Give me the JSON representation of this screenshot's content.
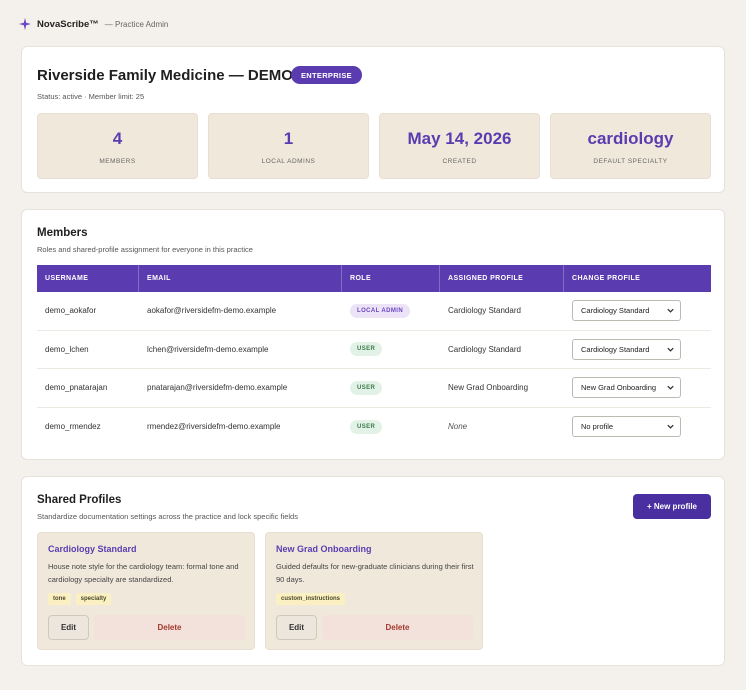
{
  "header": {
    "brand": "NovaScribe™",
    "subtitle": "— Practice Admin",
    "icon": "sparkle-icon"
  },
  "practice": {
    "name": "Riverside Family Medicine — DEMO",
    "plan_badge": "ENTERPRISE",
    "status_line": "Status: active · Member limit: 25",
    "stats": [
      {
        "value": "4",
        "label": "MEMBERS"
      },
      {
        "value": "1",
        "label": "LOCAL ADMINS"
      },
      {
        "value": "May 14, 2026",
        "label": "CREATED"
      },
      {
        "value": "cardiology",
        "label": "DEFAULT SPECIALTY"
      }
    ]
  },
  "members": {
    "title": "Members",
    "subtitle": "Roles and shared-profile assignment for everyone in this practice",
    "columns": [
      "USERNAME",
      "EMAIL",
      "ROLE",
      "ASSIGNED PROFILE",
      "CHANGE PROFILE"
    ],
    "rows": [
      {
        "username": "demo_aokafor",
        "email": "aokafor@riversidefm-demo.example",
        "role": "LOCAL ADMIN",
        "role_kind": "admin",
        "assigned": "Cardiology Standard",
        "change": "Cardiology Standard"
      },
      {
        "username": "demo_lchen",
        "email": "lchen@riversidefm-demo.example",
        "role": "USER",
        "role_kind": "user",
        "assigned": "Cardiology Standard",
        "change": "Cardiology Standard"
      },
      {
        "username": "demo_pnatarajan",
        "email": "pnatarajan@riversidefm-demo.example",
        "role": "USER",
        "role_kind": "user",
        "assigned": "New Grad Onboarding",
        "change": "New Grad Onboarding"
      },
      {
        "username": "demo_rmendez",
        "email": "rmendez@riversidefm-demo.example",
        "role": "USER",
        "role_kind": "user",
        "assigned": "None",
        "change": "No profile"
      }
    ]
  },
  "profiles": {
    "title": "Shared Profiles",
    "subtitle": "Standardize documentation settings across the practice and lock specific fields",
    "new_button": "+ New profile",
    "items": [
      {
        "name": "Cardiology Standard",
        "description": "House note style for the cardiology team: formal tone and cardiology specialty are standardized.",
        "tags": [
          "tone",
          "specialty"
        ],
        "edit": "Edit",
        "delete": "Delete"
      },
      {
        "name": "New Grad Onboarding",
        "description": "Guided defaults for new-graduate clinicians during their first 90 days.",
        "tags": [
          "custom_instructions"
        ],
        "edit": "Edit",
        "delete": "Delete"
      }
    ]
  },
  "colors": {
    "accent": "#5b3cb0",
    "background": "#f4f1ec",
    "stat_bg": "#f1e8dc",
    "delete": "#a33a2e"
  }
}
